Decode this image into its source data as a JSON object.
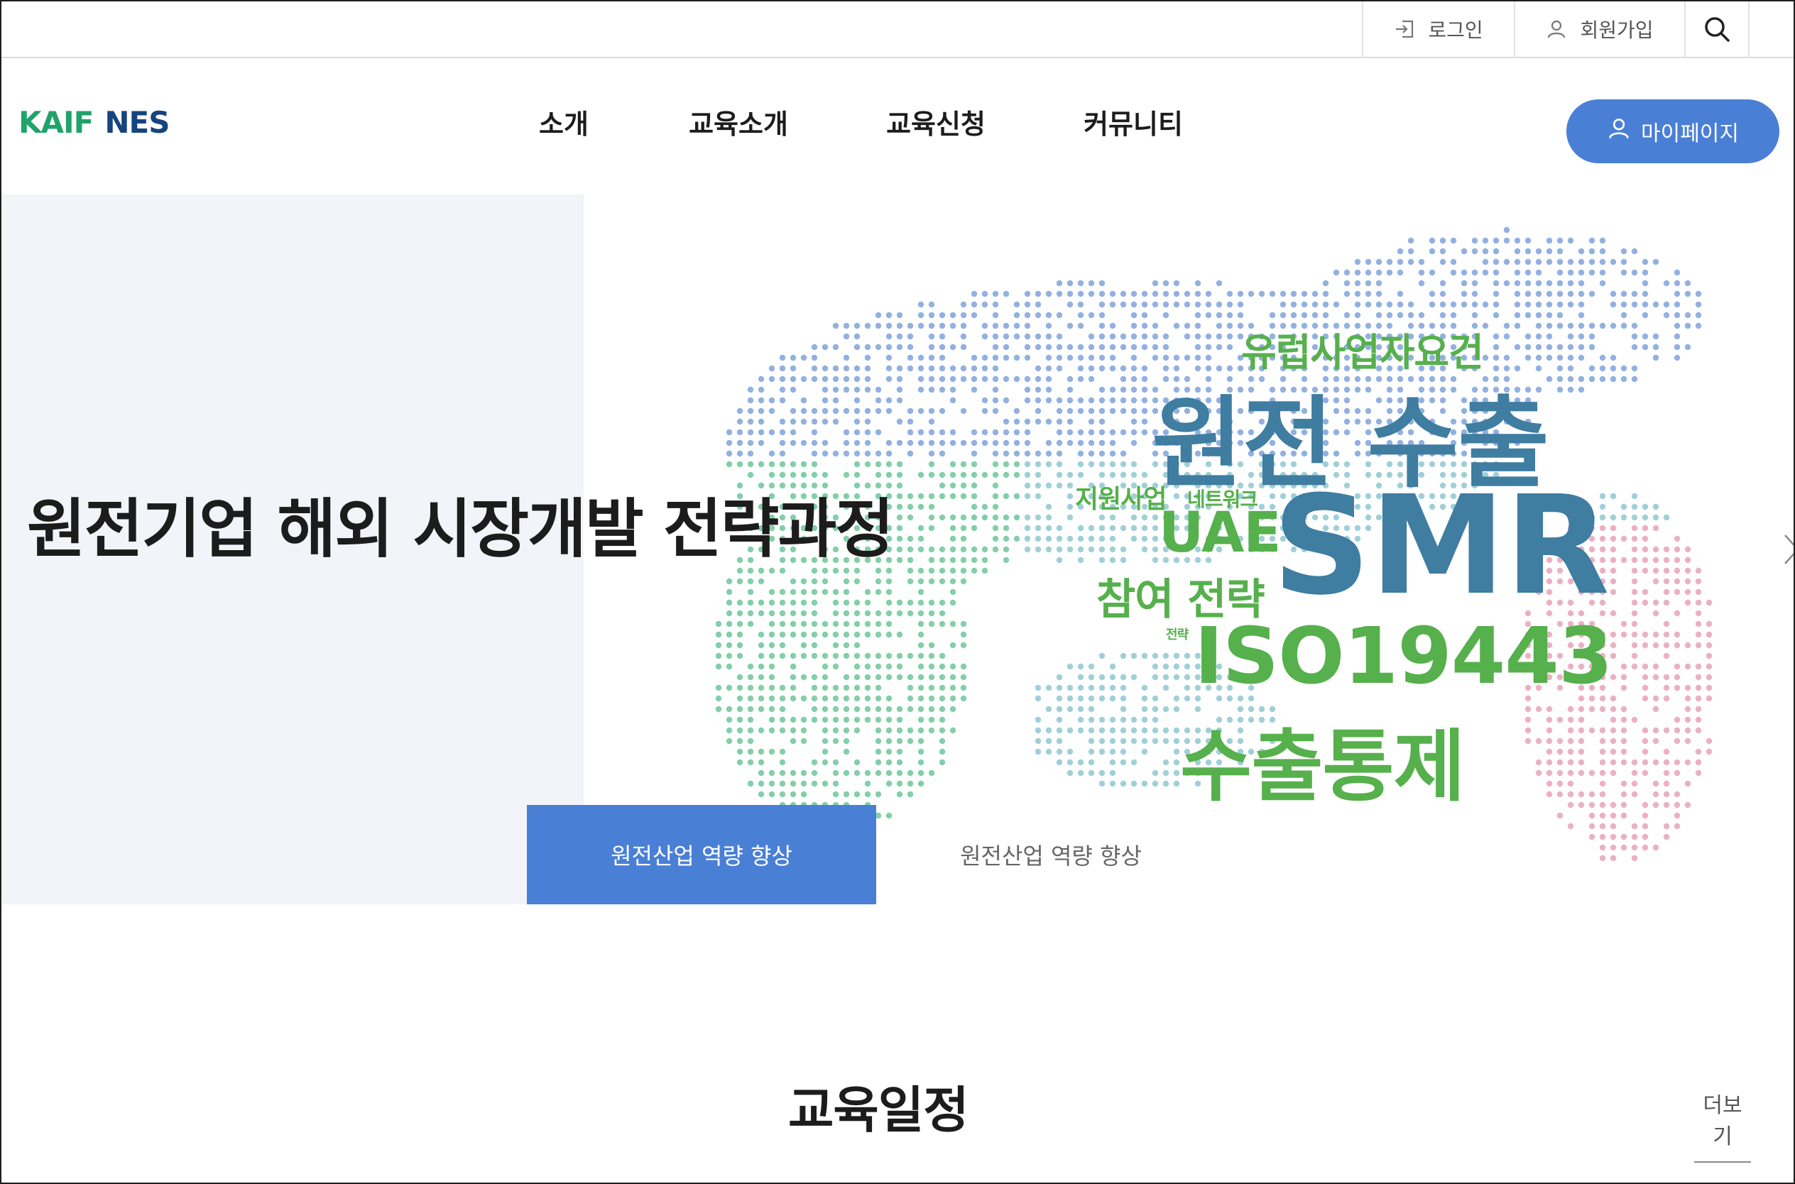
{
  "utility": {
    "login_label": "로그인",
    "join_label": "회원가입"
  },
  "logo": {
    "part1": "KAIF",
    "part2": "NES"
  },
  "nav": {
    "items": [
      "소개",
      "교육소개",
      "교육신청",
      "커뮤니티"
    ]
  },
  "mypage_label": "마이페이지",
  "hero": {
    "title": "원전기업 해외 시장개발 전략과정",
    "keywords": {
      "europe": "유럽사업자요건",
      "export": "원전 수출",
      "support": "지원사업",
      "network": "네트워크",
      "smr": "SMR",
      "uae": "UAE",
      "participate": "참여 전략",
      "strategy_small": "전략",
      "iso": "ISO19443",
      "control": "수출통제"
    },
    "tabs": [
      {
        "label": "원전산업 역량 향상",
        "active": true
      },
      {
        "label": "원전산업 역량 향상",
        "active": false
      }
    ]
  },
  "schedule": {
    "title": "교육일정",
    "more_label": "더보기"
  },
  "colors": {
    "accent": "#4a7fd6",
    "logo_green": "#1fa36a",
    "logo_navy": "#15447e",
    "keyword_green": "#56b04c",
    "keyword_blue": "#3f7da1"
  },
  "icons": {
    "login": "login-icon",
    "user": "user-icon",
    "search": "search-icon",
    "next": "chevron-right-icon"
  }
}
